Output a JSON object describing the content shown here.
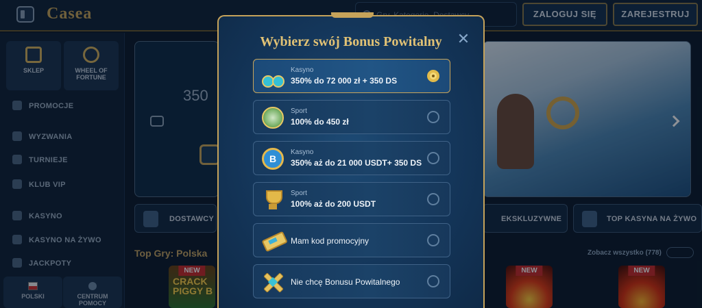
{
  "header": {
    "logo": "Casea",
    "search_placeholder": "Gry, Kategorie, Dostawcy",
    "login_label": "ZALOGUJ SIĘ",
    "register_label": "ZAREJESTRUJ"
  },
  "sidebar": {
    "tiles": [
      {
        "label": "SKLEP",
        "icon": "shopping-bag-icon"
      },
      {
        "label": "WHEEL OF FORTUNE",
        "icon": "wheel-icon"
      }
    ],
    "items": [
      {
        "label": "PROMOCJE",
        "icon": "gift-icon"
      },
      {
        "label": "WYZWANIA",
        "icon": "target-icon"
      },
      {
        "label": "TURNIEJE",
        "icon": "trophy-icon"
      },
      {
        "label": "KLUB VIP",
        "icon": "diamond-icon"
      },
      {
        "label": "KASYNO",
        "icon": "slot-icon"
      },
      {
        "label": "KASYNO NA ŻYWO",
        "icon": "live-icon"
      },
      {
        "label": "JACKPOTY",
        "icon": "clover-icon"
      }
    ],
    "language_label": "POLSKI",
    "help_label": "CENTRUM POMOCY"
  },
  "main": {
    "banner_text": "350",
    "categories": [
      {
        "label": "DOSTAWCY"
      },
      {
        "label": "EKSKLUZYWNE"
      },
      {
        "label": "TOP KASYNA NA ŻYWO"
      }
    ],
    "section_title": "Top Gry: Polska",
    "see_all": "Zobacz wszystko (778)",
    "games": [
      {
        "badge": "NEW",
        "title": "CRACK PIGGY B"
      },
      {
        "badge": "NEW",
        "title": ""
      },
      {
        "badge": "NEW",
        "title": ""
      }
    ]
  },
  "modal": {
    "title": "Wybierz swój Bonus Powitalny",
    "close_symbol": "✕",
    "options": [
      {
        "category": "Kasyno",
        "text": "350% do 72 000 zł + 350 DS",
        "icon": "cherries-icon",
        "selected": true
      },
      {
        "category": "Sport",
        "text": "100% do 450 zł",
        "icon": "soccer-ball-icon",
        "selected": false
      },
      {
        "category": "Kasyno",
        "text": "350% aż do 21 000 USDT+ 350 DS",
        "icon": "bitcoin-coin-icon",
        "selected": false
      },
      {
        "category": "Sport",
        "text": "100% aż do 200 USDT",
        "icon": "trophy-icon",
        "selected": false
      },
      {
        "category": "",
        "text": "Mam kod promocyjny",
        "icon": "ticket-icon",
        "selected": false
      },
      {
        "category": "",
        "text": "Nie chcę Bonusu Powitalnego",
        "icon": "cross-icon",
        "selected": false
      }
    ]
  },
  "colors": {
    "accent_gold": "#c6a35a",
    "background": "#0b1a2c",
    "selected_radio": "#e2bb4b"
  }
}
